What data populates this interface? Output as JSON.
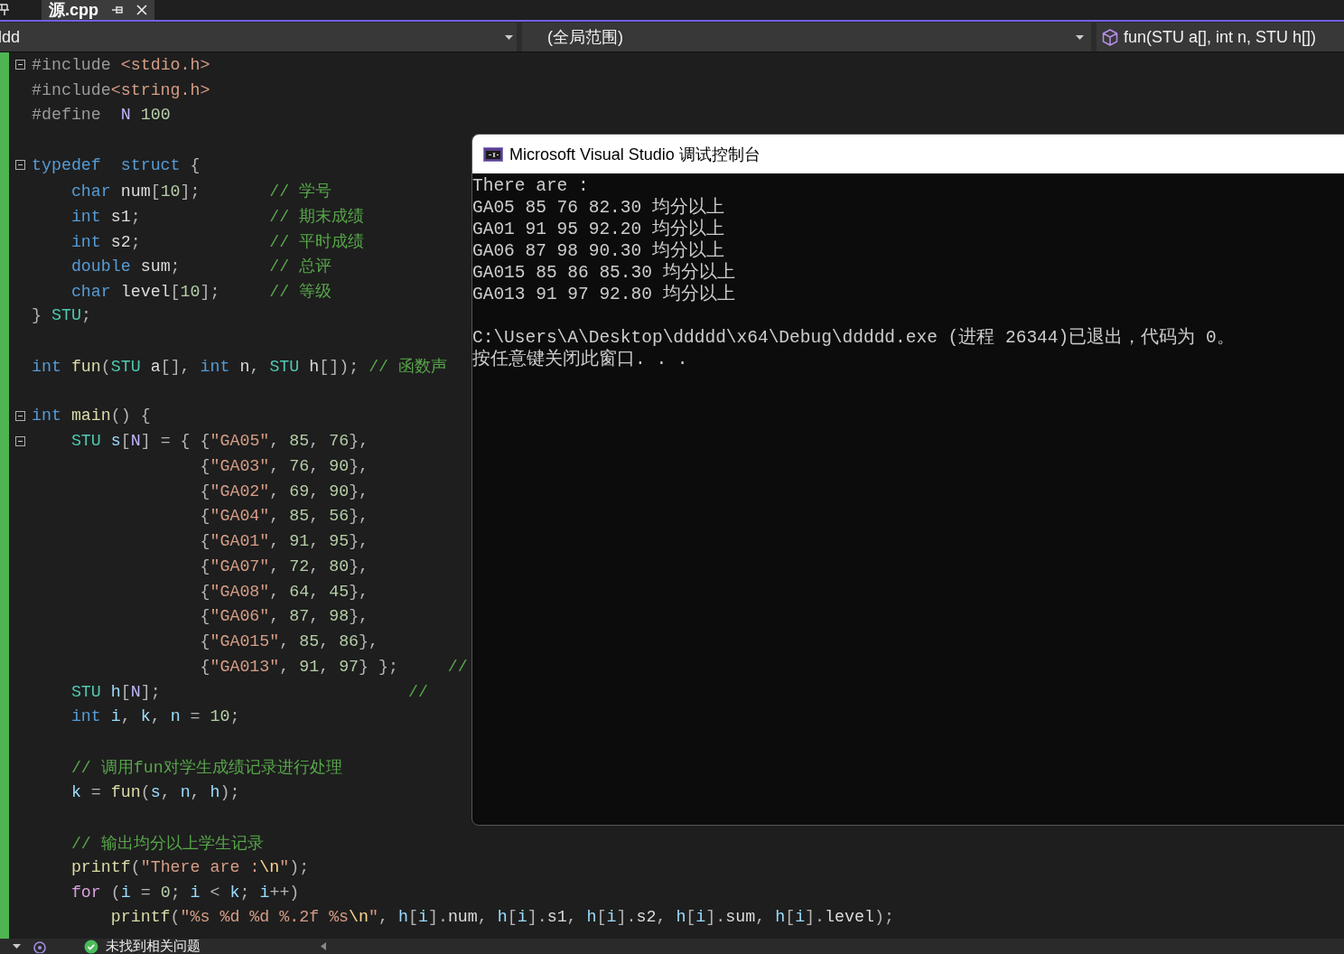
{
  "tabs": [
    {
      "label": "源.cpp",
      "selected": true
    }
  ],
  "nav": {
    "project": "ldd",
    "scope": "(全局范围)",
    "member": "fun(STU a[], int n, STU h[])"
  },
  "code_lines": [
    {
      "kind": "code",
      "fold": true,
      "tokens": [
        {
          "kind": "pre",
          "text": "#include "
        },
        {
          "kind": "str",
          "text": "<stdio.h>"
        }
      ]
    },
    {
      "kind": "code",
      "fold": false,
      "tokens": [
        {
          "kind": "pre",
          "text": "#include"
        },
        {
          "kind": "str",
          "text": "<string.h>"
        }
      ]
    },
    {
      "kind": "code",
      "fold": false,
      "tokens": [
        {
          "kind": "pre",
          "text": "#define  "
        },
        {
          "kind": "macro",
          "text": "N "
        },
        {
          "kind": "num",
          "text": "100"
        }
      ]
    },
    {
      "kind": "blank"
    },
    {
      "kind": "code",
      "fold": true,
      "tokens": [
        {
          "kind": "kw",
          "text": "typedef  struct "
        },
        {
          "kind": "punc",
          "text": "{"
        }
      ]
    },
    {
      "kind": "code",
      "fold": false,
      "tokens": [
        {
          "kind": "kw",
          "text": "    char"
        },
        {
          "kind": "plain",
          "text": " num"
        },
        {
          "kind": "punc",
          "text": "["
        },
        {
          "kind": "num",
          "text": "10"
        },
        {
          "kind": "punc",
          "text": "];       "
        },
        {
          "kind": "com",
          "text": "// 学号"
        }
      ]
    },
    {
      "kind": "code",
      "fold": false,
      "tokens": [
        {
          "kind": "kw",
          "text": "    int"
        },
        {
          "kind": "plain",
          "text": " s1"
        },
        {
          "kind": "punc",
          "text": ";             "
        },
        {
          "kind": "com",
          "text": "// 期末成绩"
        }
      ]
    },
    {
      "kind": "code",
      "fold": false,
      "tokens": [
        {
          "kind": "kw",
          "text": "    int"
        },
        {
          "kind": "plain",
          "text": " s2"
        },
        {
          "kind": "punc",
          "text": ";             "
        },
        {
          "kind": "com",
          "text": "// 平时成绩"
        }
      ]
    },
    {
      "kind": "code",
      "fold": false,
      "tokens": [
        {
          "kind": "kw",
          "text": "    double"
        },
        {
          "kind": "plain",
          "text": " sum"
        },
        {
          "kind": "punc",
          "text": ";         "
        },
        {
          "kind": "com",
          "text": "// 总评"
        }
      ]
    },
    {
      "kind": "code",
      "fold": false,
      "tokens": [
        {
          "kind": "kw",
          "text": "    char"
        },
        {
          "kind": "plain",
          "text": " level"
        },
        {
          "kind": "punc",
          "text": "["
        },
        {
          "kind": "num",
          "text": "10"
        },
        {
          "kind": "punc",
          "text": "];     "
        },
        {
          "kind": "com",
          "text": "// 等级"
        }
      ]
    },
    {
      "kind": "code",
      "fold": false,
      "tokens": [
        {
          "kind": "punc",
          "text": "} "
        },
        {
          "kind": "type",
          "text": "STU"
        },
        {
          "kind": "punc",
          "text": ";"
        }
      ]
    },
    {
      "kind": "blank"
    },
    {
      "kind": "code",
      "fold": false,
      "tokens": [
        {
          "kind": "kw",
          "text": "int "
        },
        {
          "kind": "fn",
          "text": "fun"
        },
        {
          "kind": "punc",
          "text": "("
        },
        {
          "kind": "type",
          "text": "STU"
        },
        {
          "kind": "plain",
          "text": " a"
        },
        {
          "kind": "punc",
          "text": "[], "
        },
        {
          "kind": "kw",
          "text": "int"
        },
        {
          "kind": "plain",
          "text": " n"
        },
        {
          "kind": "punc",
          "text": ", "
        },
        {
          "kind": "type",
          "text": "STU"
        },
        {
          "kind": "plain",
          "text": " h"
        },
        {
          "kind": "punc",
          "text": "[]); "
        },
        {
          "kind": "com",
          "text": "// 函数声"
        }
      ]
    },
    {
      "kind": "blank"
    },
    {
      "kind": "code",
      "fold": true,
      "tokens": [
        {
          "kind": "kw",
          "text": "int "
        },
        {
          "kind": "fn",
          "text": "main"
        },
        {
          "kind": "punc",
          "text": "() {"
        }
      ]
    },
    {
      "kind": "code",
      "fold": true,
      "tokens": [
        {
          "kind": "type",
          "text": "    STU"
        },
        {
          "kind": "var",
          "text": " s"
        },
        {
          "kind": "punc",
          "text": "["
        },
        {
          "kind": "macro",
          "text": "N"
        },
        {
          "kind": "punc",
          "text": "] = { {"
        },
        {
          "kind": "str",
          "text": "\"GA05\""
        },
        {
          "kind": "punc",
          "text": ", "
        },
        {
          "kind": "num",
          "text": "85"
        },
        {
          "kind": "punc",
          "text": ", "
        },
        {
          "kind": "num",
          "text": "76"
        },
        {
          "kind": "punc",
          "text": "},"
        }
      ]
    },
    {
      "kind": "code",
      "fold": false,
      "tokens": [
        {
          "kind": "punc",
          "text": "                 {"
        },
        {
          "kind": "str",
          "text": "\"GA03\""
        },
        {
          "kind": "punc",
          "text": ", "
        },
        {
          "kind": "num",
          "text": "76"
        },
        {
          "kind": "punc",
          "text": ", "
        },
        {
          "kind": "num",
          "text": "90"
        },
        {
          "kind": "punc",
          "text": "},"
        }
      ]
    },
    {
      "kind": "code",
      "fold": false,
      "tokens": [
        {
          "kind": "punc",
          "text": "                 {"
        },
        {
          "kind": "str",
          "text": "\"GA02\""
        },
        {
          "kind": "punc",
          "text": ", "
        },
        {
          "kind": "num",
          "text": "69"
        },
        {
          "kind": "punc",
          "text": ", "
        },
        {
          "kind": "num",
          "text": "90"
        },
        {
          "kind": "punc",
          "text": "},"
        }
      ]
    },
    {
      "kind": "code",
      "fold": false,
      "tokens": [
        {
          "kind": "punc",
          "text": "                 {"
        },
        {
          "kind": "str",
          "text": "\"GA04\""
        },
        {
          "kind": "punc",
          "text": ", "
        },
        {
          "kind": "num",
          "text": "85"
        },
        {
          "kind": "punc",
          "text": ", "
        },
        {
          "kind": "num",
          "text": "56"
        },
        {
          "kind": "punc",
          "text": "},"
        }
      ]
    },
    {
      "kind": "code",
      "fold": false,
      "tokens": [
        {
          "kind": "punc",
          "text": "                 {"
        },
        {
          "kind": "str",
          "text": "\"GA01\""
        },
        {
          "kind": "punc",
          "text": ", "
        },
        {
          "kind": "num",
          "text": "91"
        },
        {
          "kind": "punc",
          "text": ", "
        },
        {
          "kind": "num",
          "text": "95"
        },
        {
          "kind": "punc",
          "text": "},"
        }
      ]
    },
    {
      "kind": "code",
      "fold": false,
      "tokens": [
        {
          "kind": "punc",
          "text": "                 {"
        },
        {
          "kind": "str",
          "text": "\"GA07\""
        },
        {
          "kind": "punc",
          "text": ", "
        },
        {
          "kind": "num",
          "text": "72"
        },
        {
          "kind": "punc",
          "text": ", "
        },
        {
          "kind": "num",
          "text": "80"
        },
        {
          "kind": "punc",
          "text": "},"
        }
      ]
    },
    {
      "kind": "code",
      "fold": false,
      "tokens": [
        {
          "kind": "punc",
          "text": "                 {"
        },
        {
          "kind": "str",
          "text": "\"GA08\""
        },
        {
          "kind": "punc",
          "text": ", "
        },
        {
          "kind": "num",
          "text": "64"
        },
        {
          "kind": "punc",
          "text": ", "
        },
        {
          "kind": "num",
          "text": "45"
        },
        {
          "kind": "punc",
          "text": "},"
        }
      ]
    },
    {
      "kind": "code",
      "fold": false,
      "tokens": [
        {
          "kind": "punc",
          "text": "                 {"
        },
        {
          "kind": "str",
          "text": "\"GA06\""
        },
        {
          "kind": "punc",
          "text": ", "
        },
        {
          "kind": "num",
          "text": "87"
        },
        {
          "kind": "punc",
          "text": ", "
        },
        {
          "kind": "num",
          "text": "98"
        },
        {
          "kind": "punc",
          "text": "},"
        }
      ]
    },
    {
      "kind": "code",
      "fold": false,
      "tokens": [
        {
          "kind": "punc",
          "text": "                 {"
        },
        {
          "kind": "str",
          "text": "\"GA015\""
        },
        {
          "kind": "punc",
          "text": ", "
        },
        {
          "kind": "num",
          "text": "85"
        },
        {
          "kind": "punc",
          "text": ", "
        },
        {
          "kind": "num",
          "text": "86"
        },
        {
          "kind": "punc",
          "text": "},"
        }
      ]
    },
    {
      "kind": "code",
      "fold": false,
      "tokens": [
        {
          "kind": "punc",
          "text": "                 {"
        },
        {
          "kind": "str",
          "text": "\"GA013\""
        },
        {
          "kind": "punc",
          "text": ", "
        },
        {
          "kind": "num",
          "text": "91"
        },
        {
          "kind": "punc",
          "text": ", "
        },
        {
          "kind": "num",
          "text": "97"
        },
        {
          "kind": "punc",
          "text": "} };     "
        },
        {
          "kind": "com",
          "text": "//"
        }
      ]
    },
    {
      "kind": "code",
      "fold": false,
      "tokens": [
        {
          "kind": "type",
          "text": "    STU"
        },
        {
          "kind": "var",
          "text": " h"
        },
        {
          "kind": "punc",
          "text": "["
        },
        {
          "kind": "macro",
          "text": "N"
        },
        {
          "kind": "punc",
          "text": "];                         "
        },
        {
          "kind": "com",
          "text": "//"
        }
      ]
    },
    {
      "kind": "code",
      "fold": false,
      "tokens": [
        {
          "kind": "kw",
          "text": "    int"
        },
        {
          "kind": "var",
          "text": " i"
        },
        {
          "kind": "punc",
          "text": ", "
        },
        {
          "kind": "var",
          "text": "k"
        },
        {
          "kind": "punc",
          "text": ", "
        },
        {
          "kind": "var",
          "text": "n"
        },
        {
          "kind": "punc",
          "text": " = "
        },
        {
          "kind": "num",
          "text": "10"
        },
        {
          "kind": "punc",
          "text": ";"
        }
      ]
    },
    {
      "kind": "blank"
    },
    {
      "kind": "code",
      "fold": false,
      "tokens": [
        {
          "kind": "com",
          "text": "    // 调用fun对学生成绩记录进行处理"
        }
      ]
    },
    {
      "kind": "code",
      "fold": false,
      "tokens": [
        {
          "kind": "var",
          "text": "    k"
        },
        {
          "kind": "punc",
          "text": " = "
        },
        {
          "kind": "fn",
          "text": "fun"
        },
        {
          "kind": "punc",
          "text": "("
        },
        {
          "kind": "var",
          "text": "s"
        },
        {
          "kind": "punc",
          "text": ", "
        },
        {
          "kind": "var",
          "text": "n"
        },
        {
          "kind": "punc",
          "text": ", "
        },
        {
          "kind": "var",
          "text": "h"
        },
        {
          "kind": "punc",
          "text": ");"
        }
      ]
    },
    {
      "kind": "blank"
    },
    {
      "kind": "code",
      "fold": false,
      "tokens": [
        {
          "kind": "com",
          "text": "    // 输出均分以上学生记录"
        }
      ]
    },
    {
      "kind": "code",
      "fold": false,
      "tokens": [
        {
          "kind": "fn",
          "text": "    printf"
        },
        {
          "kind": "punc",
          "text": "("
        },
        {
          "kind": "str",
          "text": "\"There are :"
        },
        {
          "kind": "esc",
          "text": "\\n"
        },
        {
          "kind": "str",
          "text": "\""
        },
        {
          "kind": "punc",
          "text": ");"
        }
      ]
    },
    {
      "kind": "code",
      "fold": false,
      "tokens": [
        {
          "kind": "ctl",
          "text": "    for"
        },
        {
          "kind": "punc",
          "text": " ("
        },
        {
          "kind": "var",
          "text": "i"
        },
        {
          "kind": "punc",
          "text": " = "
        },
        {
          "kind": "num",
          "text": "0"
        },
        {
          "kind": "punc",
          "text": "; "
        },
        {
          "kind": "var",
          "text": "i"
        },
        {
          "kind": "punc",
          "text": " < "
        },
        {
          "kind": "var",
          "text": "k"
        },
        {
          "kind": "punc",
          "text": "; "
        },
        {
          "kind": "var",
          "text": "i"
        },
        {
          "kind": "punc",
          "text": "++)"
        }
      ]
    },
    {
      "kind": "code",
      "fold": false,
      "tokens": [
        {
          "kind": "fn",
          "text": "        printf"
        },
        {
          "kind": "punc",
          "text": "("
        },
        {
          "kind": "str",
          "text": "\"%s %d %d %.2f %s"
        },
        {
          "kind": "esc",
          "text": "\\n"
        },
        {
          "kind": "str",
          "text": "\""
        },
        {
          "kind": "punc",
          "text": ", "
        },
        {
          "kind": "var",
          "text": "h"
        },
        {
          "kind": "punc",
          "text": "["
        },
        {
          "kind": "var",
          "text": "i"
        },
        {
          "kind": "punc",
          "text": "]."
        },
        {
          "kind": "plain",
          "text": "num"
        },
        {
          "kind": "punc",
          "text": ", "
        },
        {
          "kind": "var",
          "text": "h"
        },
        {
          "kind": "punc",
          "text": "["
        },
        {
          "kind": "var",
          "text": "i"
        },
        {
          "kind": "punc",
          "text": "]."
        },
        {
          "kind": "plain",
          "text": "s1"
        },
        {
          "kind": "punc",
          "text": ", "
        },
        {
          "kind": "var",
          "text": "h"
        },
        {
          "kind": "punc",
          "text": "["
        },
        {
          "kind": "var",
          "text": "i"
        },
        {
          "kind": "punc",
          "text": "]."
        },
        {
          "kind": "plain",
          "text": "s2"
        },
        {
          "kind": "punc",
          "text": ", "
        },
        {
          "kind": "var",
          "text": "h"
        },
        {
          "kind": "punc",
          "text": "["
        },
        {
          "kind": "var",
          "text": "i"
        },
        {
          "kind": "punc",
          "text": "]."
        },
        {
          "kind": "plain",
          "text": "sum"
        },
        {
          "kind": "punc",
          "text": ", "
        },
        {
          "kind": "var",
          "text": "h"
        },
        {
          "kind": "punc",
          "text": "["
        },
        {
          "kind": "var",
          "text": "i"
        },
        {
          "kind": "punc",
          "text": "]."
        },
        {
          "kind": "plain",
          "text": "level"
        },
        {
          "kind": "punc",
          "text": ");"
        }
      ]
    }
  ],
  "console": {
    "title": "Microsoft Visual Studio 调试控制台",
    "lines": [
      {
        "kind": "text",
        "text": "There are :"
      },
      {
        "kind": "text",
        "text": "GA05 85 76 82.30 均分以上"
      },
      {
        "kind": "text",
        "text": "GA01 91 95 92.20 均分以上"
      },
      {
        "kind": "text",
        "text": "GA06 87 98 90.30 均分以上"
      },
      {
        "kind": "text",
        "text": "GA015 85 86 85.30 均分以上"
      },
      {
        "kind": "text",
        "text": "GA013 91 97 92.80 均分以上"
      },
      {
        "kind": "blank"
      },
      {
        "kind": "text",
        "text": "C:\\Users\\A\\Desktop\\ddddd\\x64\\Debug\\ddddd.exe (进程 26344)已退出，代码为 0。"
      },
      {
        "kind": "text",
        "text": "按任意键关闭此窗口. . ."
      }
    ]
  },
  "status_bar": {
    "issues": "未找到相关问题"
  }
}
